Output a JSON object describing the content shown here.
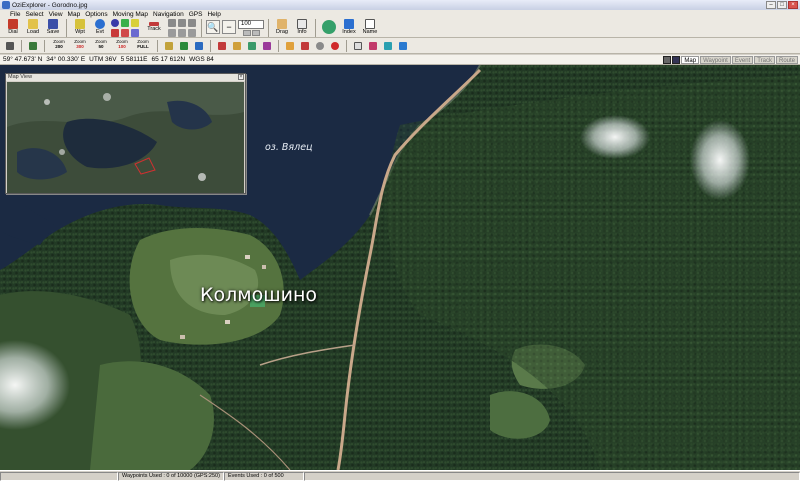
{
  "window": {
    "title": "OziExplorer - Gorodno.jpg",
    "buttons": [
      "–",
      "□",
      "×"
    ]
  },
  "menu": [
    "File",
    "Select",
    "View",
    "Map",
    "Options",
    "Moving Map",
    "Navigation",
    "GPS",
    "Help"
  ],
  "toolbar1": {
    "dial_label": "Dial",
    "load_label": "Load",
    "save_label": "Save",
    "wpt_label": "Wpt",
    "evt_label": "Evt",
    "track_label": "Track",
    "zoom_value": "100",
    "drag_label": "Drag",
    "info_label": "Info",
    "index_label": "Index",
    "name_label": "Name"
  },
  "toolbar2": {
    "zoom_buttons": [
      {
        "label": "Zoom",
        "value": "200"
      },
      {
        "label": "Zoom",
        "value": "300"
      },
      {
        "label": "Zoom",
        "value": "50"
      },
      {
        "label": "Zoom",
        "value": "100"
      },
      {
        "label": "Zoom",
        "value": "FULL"
      }
    ]
  },
  "status": {
    "lat": "59° 47.673' N",
    "lon": "34° 00.330' E",
    "utm": "UTM 36V",
    "easting": "5 58111E",
    "northing": "65 17 612N",
    "datum": "WGS 84",
    "tabs": [
      "Map",
      "Waypoint",
      "Event",
      "Track",
      "Route"
    ],
    "active_tab": "Map"
  },
  "map": {
    "lake_label": "оз. Вялец",
    "town_label": "Колмошино"
  },
  "map_view": {
    "title": "Map View",
    "close": "×"
  },
  "bottom": {
    "waypoints": "Waypoints Used : 0 of 10000  (GPS:250)",
    "events": "Events Used : 0 of 500"
  },
  "colors": {
    "lake": "#1b2a43",
    "forest_dark": "#1c2b1e",
    "forest_light": "#3a5a32",
    "field": "#6d8a55",
    "road": "#c9a88a",
    "chrome": "#ece9e2"
  }
}
